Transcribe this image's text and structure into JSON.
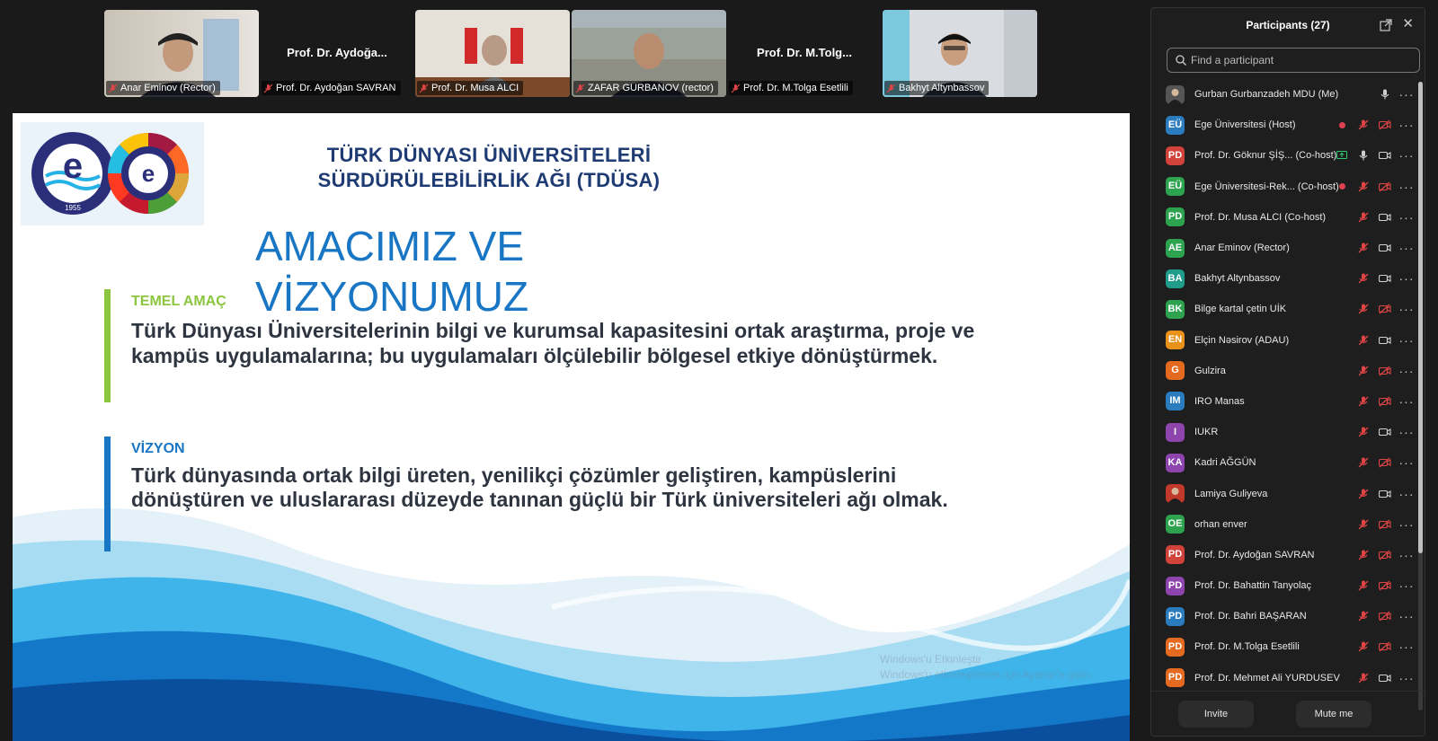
{
  "video_tiles": [
    {
      "name": "Anar Eminov (Rector)",
      "big_name": "",
      "has_video": true
    },
    {
      "name": "Prof. Dr. Aydoğan SAVRAN",
      "big_name": "Prof. Dr. Aydoğa...",
      "has_video": false
    },
    {
      "name": "Prof. Dr. Musa ALCI",
      "big_name": "",
      "has_video": true
    },
    {
      "name": "ZAFAR GURBANOV (rector)",
      "big_name": "",
      "has_video": true
    },
    {
      "name": "Prof. Dr. M.Tolga Esetlili",
      "big_name": "Prof. Dr. M.Tolg...",
      "has_video": false
    },
    {
      "name": "Bakhyt Altynbassov",
      "big_name": "",
      "has_video": true
    }
  ],
  "slide": {
    "title_line1": "TÜRK DÜNYASI ÜNİVERSİTELERİ",
    "title_line2": "SÜRDÜRÜLEBİLİRLİK AĞI (TDÜSA)",
    "heading": "AMACIMIZ VE VİZYONUMUZ",
    "section1_label": "TEMEL AMAÇ",
    "section1_body": "Türk Dünyası Üniversitelerinin bilgi ve kurumsal kapasitesini ortak araştırma, proje ve kampüs uygulamalarına; bu uygulamaları ölçülebilir bölgesel etkiye dönüştürmek.",
    "section2_label": "VİZYON",
    "section2_body": "Türk dünyasında ortak bilgi üreten, yenilikçi çözümler geliştiren, kampüslerini dönüştüren ve uluslararası düzeyde tanınan güçlü bir Türk üniversiteleri ağı olmak.",
    "logo_year": "1955",
    "logo_text": "EGE ÜNİVERSİTESİ",
    "watermark_line1": "Windows'u Etkinleştir",
    "watermark_line2": "Windows'u etkinleştirmek için Ayarlar'a gidin."
  },
  "colors": {
    "accent_green": "#8cc63f",
    "accent_blue": "#1976c4",
    "title_navy": "#1f3b73"
  },
  "participants_panel": {
    "title": "Participants (27)",
    "search_placeholder": "Find a participant",
    "invite_label": "Invite",
    "mute_me_label": "Mute me",
    "participants": [
      {
        "initials": "",
        "name": "Gurban Gurbanzadeh MDU (Me)",
        "color": "#555555",
        "photo": true,
        "mic": "on",
        "video": "none",
        "rec": false,
        "share": false
      },
      {
        "initials": "EÜ",
        "name": "Ege Üniversitesi (Host)",
        "color": "#2b7bbf",
        "photo": false,
        "mic": "off",
        "video": "off",
        "rec": true,
        "share": false
      },
      {
        "initials": "PD",
        "name": "Prof. Dr. Göknur ŞİŞ... (Co-host)",
        "color": "#d0423a",
        "photo": false,
        "mic": "on",
        "video": "on",
        "rec": false,
        "share": true
      },
      {
        "initials": "EÜ",
        "name": "Ege Üniversitesi-Rek... (Co-host)",
        "color": "#2ea34f",
        "photo": false,
        "mic": "off",
        "video": "off",
        "rec": true,
        "share": false
      },
      {
        "initials": "PD",
        "name": "Prof. Dr. Musa ALCI (Co-host)",
        "color": "#2ea34f",
        "photo": false,
        "mic": "off",
        "video": "on",
        "rec": false,
        "share": false
      },
      {
        "initials": "AE",
        "name": "Anar Eminov (Rector)",
        "color": "#2ea34f",
        "photo": false,
        "mic": "off",
        "video": "on",
        "rec": false,
        "share": false
      },
      {
        "initials": "BA",
        "name": "Bakhyt Altynbassov",
        "color": "#1f9c8a",
        "photo": false,
        "mic": "off",
        "video": "on",
        "rec": false,
        "share": false
      },
      {
        "initials": "BK",
        "name": "Bilge kartal çetin UİK",
        "color": "#2ea34f",
        "photo": false,
        "mic": "off",
        "video": "off",
        "rec": false,
        "share": false
      },
      {
        "initials": "EN",
        "name": "Elçin Nəsirov (ADAU)",
        "color": "#e8921a",
        "photo": false,
        "mic": "off",
        "video": "on",
        "rec": false,
        "share": false
      },
      {
        "initials": "G",
        "name": "Gulzira",
        "color": "#e36a1e",
        "photo": false,
        "mic": "off",
        "video": "off",
        "rec": false,
        "share": false
      },
      {
        "initials": "IM",
        "name": "IRO Manas",
        "color": "#2b7bbf",
        "photo": false,
        "mic": "off",
        "video": "off",
        "rec": false,
        "share": false
      },
      {
        "initials": "I",
        "name": "IUKR",
        "color": "#8e44ad",
        "photo": false,
        "mic": "off",
        "video": "on",
        "rec": false,
        "share": false
      },
      {
        "initials": "KA",
        "name": "Kadri AĞGÜN",
        "color": "#8e44ad",
        "photo": false,
        "mic": "off",
        "video": "off",
        "rec": false,
        "share": false
      },
      {
        "initials": "",
        "name": "Lamiya Guliyeva",
        "color": "#c0392b",
        "photo": true,
        "mic": "off",
        "video": "on",
        "rec": false,
        "share": false
      },
      {
        "initials": "OE",
        "name": "orhan enver",
        "color": "#2ea34f",
        "photo": false,
        "mic": "off",
        "video": "off",
        "rec": false,
        "share": false
      },
      {
        "initials": "PD",
        "name": "Prof. Dr. Aydoğan SAVRAN",
        "color": "#d0423a",
        "photo": false,
        "mic": "off",
        "video": "off",
        "rec": false,
        "share": false
      },
      {
        "initials": "PD",
        "name": "Prof. Dr. Bahattin Tanyolaç",
        "color": "#8e44ad",
        "photo": false,
        "mic": "off",
        "video": "off",
        "rec": false,
        "share": false
      },
      {
        "initials": "PD",
        "name": "Prof. Dr. Bahri BAŞARAN",
        "color": "#2b7bbf",
        "photo": false,
        "mic": "off",
        "video": "off",
        "rec": false,
        "share": false
      },
      {
        "initials": "PD",
        "name": "Prof. Dr. M.Tolga Esetlili",
        "color": "#e36a1e",
        "photo": false,
        "mic": "off",
        "video": "off",
        "rec": false,
        "share": false
      },
      {
        "initials": "PD",
        "name": "Prof. Dr. Mehmet Ali YURDUSEV",
        "color": "#e36a1e",
        "photo": false,
        "mic": "off",
        "video": "on",
        "rec": false,
        "share": false
      }
    ]
  }
}
